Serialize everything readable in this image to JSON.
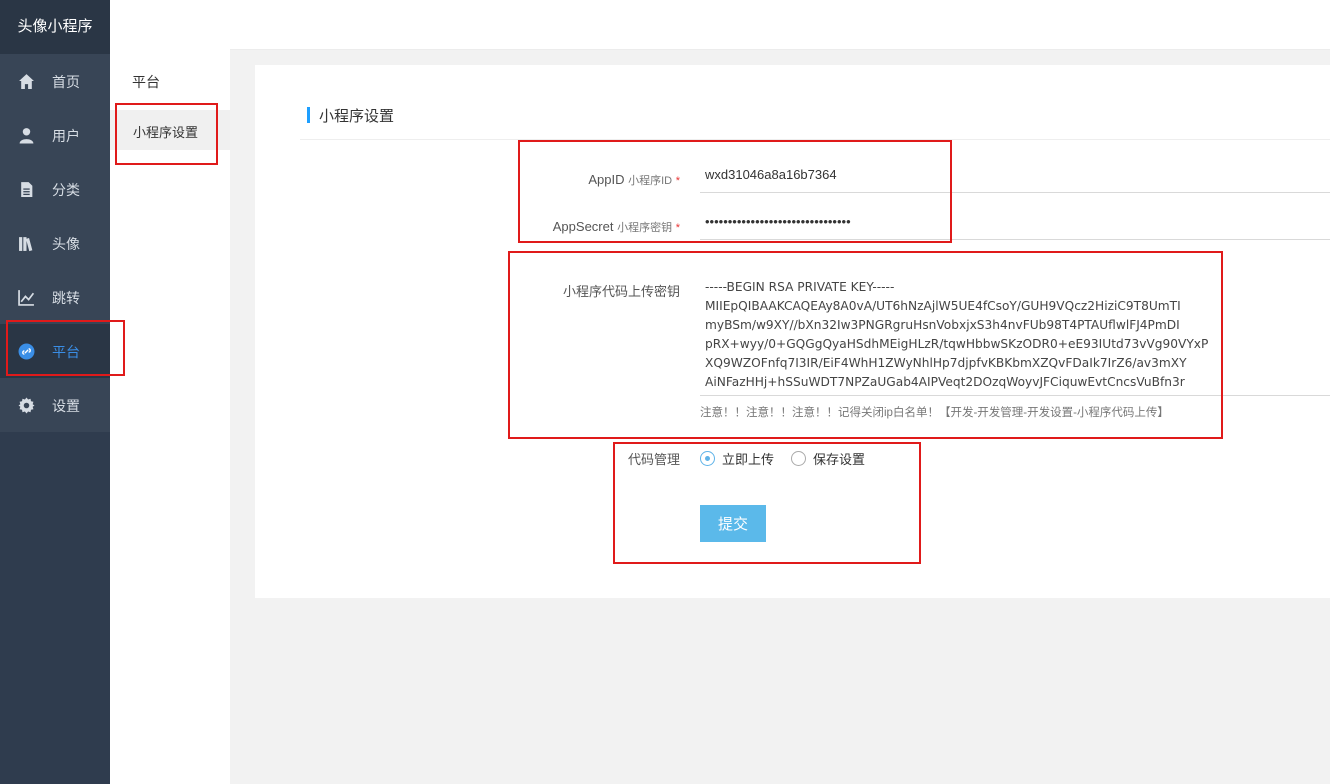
{
  "app": {
    "title": "头像小程序"
  },
  "nav": {
    "items": [
      {
        "label": "首页",
        "icon": "home-icon"
      },
      {
        "label": "用户",
        "icon": "user-icon"
      },
      {
        "label": "分类",
        "icon": "document-icon"
      },
      {
        "label": "头像",
        "icon": "books-icon"
      },
      {
        "label": "跳转",
        "icon": "chart-line-icon"
      },
      {
        "label": "平台",
        "icon": "link-icon",
        "active": true
      },
      {
        "label": "设置",
        "icon": "gear-icon"
      }
    ]
  },
  "toolbar": {
    "collapse_icon": "menu-collapse-icon",
    "refresh_icon": "refresh-icon"
  },
  "submenu": {
    "title": "平台",
    "items": [
      {
        "label": "小程序设置",
        "active": true
      }
    ]
  },
  "form": {
    "section_title": "小程序设置",
    "appid": {
      "label": "AppID",
      "sublabel": "小程序ID",
      "required_mark": "*",
      "value": "wxd31046a8a16b7364"
    },
    "appsecret": {
      "label": "AppSecret",
      "sublabel": "小程序密钥",
      "required_mark": "*",
      "value": "••••••••••••••••••••••••••••••••"
    },
    "upload_key": {
      "label": "小程序代码上传密钥",
      "lines": [
        "-----BEGIN RSA PRIVATE KEY-----",
        "MIIEpQIBAAKCAQEAy8A0vA/UT6hNzAjlW5UE4fCsoY/GUH9VQcz2HiziC9T8UmTI",
        "myBSm/w9XY//bXn32Iw3PNGRgruHsnVobxjxS3h4nvFUb98T4PTAUflwlFJ4PmDI",
        "pRX+wyy/0+GQGgQyaHSdhMEigHLzR/tqwHbbwSKzODR0+eE93IUtd73vVg90VYxP",
        "XQ9WZOFnfq7I3IR/EiF4WhH1ZWyNhlHp7djpfvKBKbmXZQvFDaIk7IrZ6/av3mXY",
        "AiNFazHHj+hSSuWDT7NPZaUGab4AIPVeqt2DOzqWoyvJFCiquwEvtCncsVuBfn3r"
      ],
      "hint": "注意！！注意！！注意！！记得关闭ip白名单！【开发-开发管理-开发设置-小程序代码上传】"
    },
    "code_management": {
      "label": "代码管理",
      "options": [
        {
          "label": "立即上传",
          "checked": true
        },
        {
          "label": "保存设置",
          "checked": false
        }
      ]
    },
    "submit_label": "提交"
  },
  "colors": {
    "sidebar": "#2f3c4e",
    "accent": "#1e9fff",
    "submit": "#5bb9ea",
    "annotation": "#e01a1a"
  }
}
